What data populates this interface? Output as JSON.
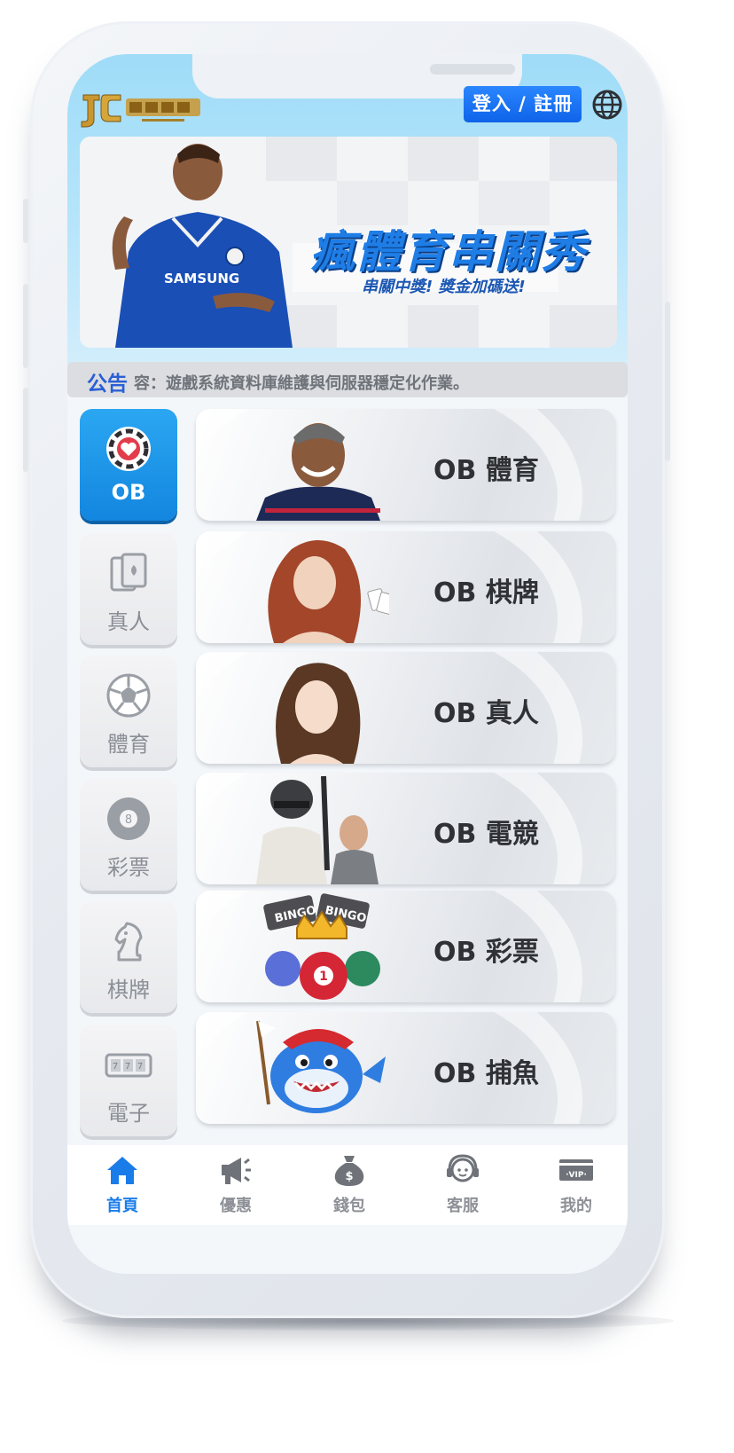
{
  "header": {
    "logo_alt": "Logo",
    "login_label": "登入 / 註冊"
  },
  "banner": {
    "title": "瘋體育串關秀",
    "subtitle": "串關中獎! 獎金加碼送!"
  },
  "notice": {
    "label": "公告",
    "text": "容：遊戲系統資料庫維護與伺服器穩定化作業。"
  },
  "categories": [
    {
      "label": "OB",
      "icon": "chip-icon",
      "active": true
    },
    {
      "label": "真人",
      "icon": "cards-icon",
      "active": false
    },
    {
      "label": "體育",
      "icon": "soccer-ball-icon",
      "active": false
    },
    {
      "label": "彩票",
      "icon": "lottery-ball-icon",
      "active": false
    },
    {
      "label": "棋牌",
      "icon": "chess-knight-icon",
      "active": false
    },
    {
      "label": "電子",
      "icon": "slot-machine-icon",
      "active": false
    }
  ],
  "games": [
    {
      "name": "OB 體育"
    },
    {
      "name": "OB 棋牌"
    },
    {
      "name": "OB 真人"
    },
    {
      "name": "OB 電競"
    },
    {
      "name": "OB 彩票"
    },
    {
      "name": "OB 捕魚"
    }
  ],
  "tabs": [
    {
      "label": "首頁",
      "icon": "home-icon",
      "active": true
    },
    {
      "label": "優惠",
      "icon": "megaphone-icon",
      "active": false
    },
    {
      "label": "錢包",
      "icon": "money-bag-icon",
      "active": false
    },
    {
      "label": "客服",
      "icon": "support-agent-icon",
      "active": false
    },
    {
      "label": "我的",
      "icon": "vip-card-icon",
      "active": false
    }
  ],
  "colors": {
    "accent": "#1a7ce8",
    "header": "#b7e5fb"
  }
}
